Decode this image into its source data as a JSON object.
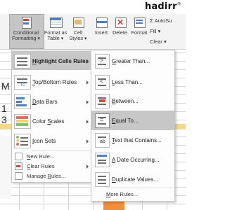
{
  "watermark": {
    "brand": "hadirr",
    "mark": "®"
  },
  "ribbon": {
    "conditional_formatting": {
      "line1": "Conditional",
      "line2": "Formatting ▾"
    },
    "format_as_table": {
      "line1": "Format as",
      "line2": "Table ▾"
    },
    "cell_styles": {
      "line1": "Cell",
      "line2": "Styles ▾"
    },
    "insert": "Insert",
    "delete": "Delete",
    "format": "Format",
    "autosum": "Σ AutoSu",
    "fill": "Fill ▾",
    "clear": "Clear ▾"
  },
  "sheet": {
    "left_letters": [
      "M",
      "1",
      "3"
    ]
  },
  "menu": {
    "items": [
      {
        "name": "highlight-cells-rules",
        "pre": "",
        "u": "H",
        "post": "ighlight Cells Rules"
      },
      {
        "name": "top-bottom-rules",
        "pre": "",
        "u": "T",
        "post": "op/Bottom Rules"
      },
      {
        "name": "data-bars",
        "pre": "",
        "u": "D",
        "post": "ata Bars"
      },
      {
        "name": "color-scales",
        "pre": "Color ",
        "u": "S",
        "post": "cales"
      },
      {
        "name": "icon-sets",
        "pre": "",
        "u": "I",
        "post": "con Sets"
      }
    ],
    "small_items": [
      {
        "name": "new-rule",
        "pre": "",
        "u": "N",
        "post": "ew Rule..."
      },
      {
        "name": "clear-rules",
        "pre": "",
        "u": "C",
        "post": "lear Rules"
      },
      {
        "name": "manage-rules",
        "pre": "Manage ",
        "u": "R",
        "post": "ules..."
      }
    ]
  },
  "submenu": {
    "items": [
      {
        "name": "greater-than",
        "pre": "",
        "u": "G",
        "post": "reater Than..."
      },
      {
        "name": "less-than",
        "pre": "",
        "u": "L",
        "post": "ess Than..."
      },
      {
        "name": "between",
        "pre": "",
        "u": "B",
        "post": "etween..."
      },
      {
        "name": "equal-to",
        "pre": "",
        "u": "E",
        "post": "qual To..."
      },
      {
        "name": "text-that-contains",
        "pre": "",
        "u": "T",
        "post": "ext that Contains..."
      },
      {
        "name": "a-date-occurring",
        "pre": "",
        "u": "A",
        "post": " Date Occurring..."
      },
      {
        "name": "duplicate-values",
        "pre": "",
        "u": "D",
        "post": "uplicate Values..."
      }
    ],
    "more_rules": {
      "pre": "",
      "u": "M",
      "post": "ore Rules..."
    }
  }
}
